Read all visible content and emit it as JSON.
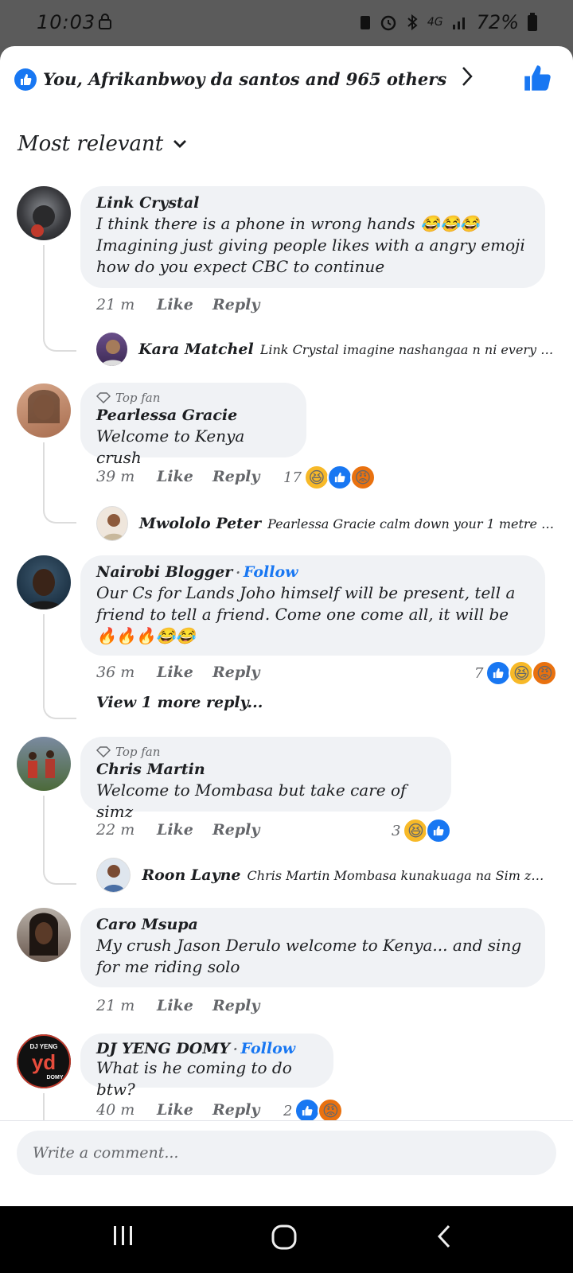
{
  "status_bar": {
    "time": "10:03",
    "battery": "72%",
    "network": "4G"
  },
  "reactions_header": {
    "text": "You, Afrikanbwoy da santos and 965 others"
  },
  "sort": {
    "label": "Most relevant"
  },
  "comments": [
    {
      "name": "Link Crystal",
      "text": "I think there is a phone in wrong hands 😂😂😂 Imagining just giving people likes with a angry emoji how do you expect CBC to continue",
      "time": "21 m",
      "like": "Like",
      "reply": "Reply",
      "reply_preview": {
        "name": "Kara Matchel",
        "text": "Link Crystal imagine nashangaa n ni every com..."
      }
    },
    {
      "badge": "Top fan",
      "name": "Pearlessa Gracie",
      "text": "Welcome to Kenya crush",
      "time": "39 m",
      "like": "Like",
      "reply": "Reply",
      "reaction_count": "17",
      "reply_preview": {
        "name": "Mwololo Peter",
        "text": "Pearlessa Gracie calm down your 1 metre clotoris"
      }
    },
    {
      "name": "Nairobi Blogger",
      "follow": "Follow",
      "text": "Our Cs for Lands Joho himself will be present, tell a friend to tell a friend. Come one come all, it will be 🔥🔥🔥😂😂",
      "time": "36 m",
      "like": "Like",
      "reply": "Reply",
      "reaction_count": "7",
      "view_more": "View 1 more reply..."
    },
    {
      "badge": "Top fan",
      "name": "Chris Martin",
      "text": "Welcome to Mombasa but take care of simz",
      "time": "22 m",
      "like": "Like",
      "reply": "Reply",
      "reaction_count": "3",
      "reply_preview": {
        "name": "Roon Layne",
        "text": "Chris Martin Mombasa kunakuaga na Sim z😂😂"
      }
    },
    {
      "name": "Caro Msupa",
      "text": "My crush Jason Derulo welcome to Kenya... and sing for me riding solo",
      "time": "21 m",
      "like": "Like",
      "reply": "Reply"
    },
    {
      "name": "DJ YENG DOMY",
      "follow": "Follow",
      "text": "What is he coming to do btw?",
      "time": "40 m",
      "like": "Like",
      "reply": "Reply",
      "reaction_count": "2",
      "avatar_logo": {
        "top": "DJ YENG",
        "mid": "yd",
        "bottom": "DOMY"
      }
    }
  ],
  "composer": {
    "placeholder": "Write a comment..."
  },
  "colors": {
    "accent": "#1877f2",
    "bubble": "#f0f2f5",
    "haha": "#f7b928",
    "angry": "#e9710f"
  }
}
